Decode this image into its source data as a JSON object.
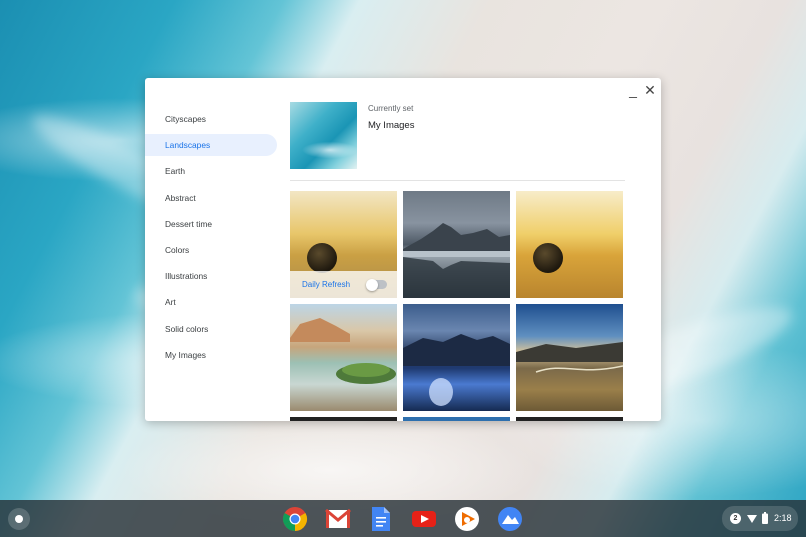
{
  "window": {
    "minimize_glyph": "_",
    "close_glyph": "✕"
  },
  "sidebar": {
    "items": [
      {
        "label": "Cityscapes",
        "active": false
      },
      {
        "label": "Landscapes",
        "active": true
      },
      {
        "label": "Earth",
        "active": false
      },
      {
        "label": "Abstract",
        "active": false
      },
      {
        "label": "Dessert time",
        "active": false
      },
      {
        "label": "Colors",
        "active": false
      },
      {
        "label": "Illustrations",
        "active": false
      },
      {
        "label": "Art",
        "active": false
      },
      {
        "label": "Solid colors",
        "active": false
      },
      {
        "label": "My Images",
        "active": false
      }
    ]
  },
  "current": {
    "caption": "Currently set",
    "name": "My Images"
  },
  "grid": {
    "daily_refresh_label": "Daily Refresh",
    "daily_refresh_on": false
  },
  "shelf": {
    "apps": [
      "chrome-icon",
      "gmail-icon",
      "docs-icon",
      "youtube-icon",
      "play-music-icon",
      "photos-icon"
    ],
    "notification_count": "2",
    "time": "2:18"
  },
  "colors": {
    "accent": "#1a73e8",
    "active_bg": "#e8f0fe"
  }
}
